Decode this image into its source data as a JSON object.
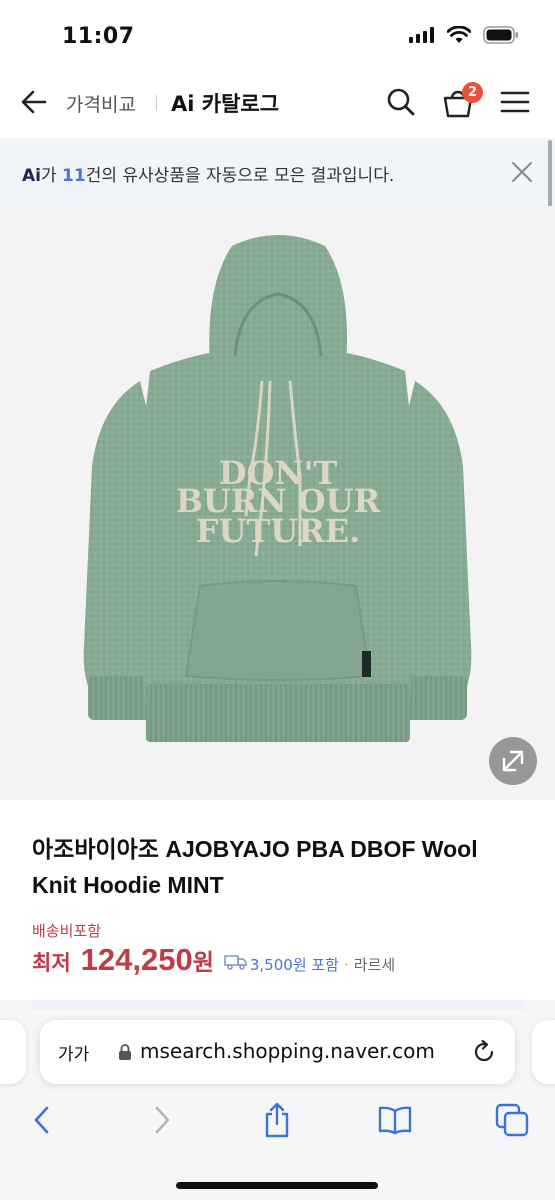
{
  "status_bar": {
    "time": "11:07"
  },
  "header": {
    "breadcrumb": "가격비교",
    "title": "Ai 카탈로그",
    "cart_badge_count": "2",
    "icons": [
      "back-arrow-icon",
      "search-icon",
      "cart-icon",
      "menu-icon"
    ]
  },
  "ai_banner": {
    "logo": "Ai",
    "text_before": "가 ",
    "count": "11",
    "text_after": "건의 유사상품을 자동으로 모은 결과입니다."
  },
  "product": {
    "image_graphic_text": "DON'T BURN OUR FUTURE.",
    "name": "아조바이아조 AJOBYAJO PBA DBOF Wool Knit Hoodie MINT",
    "shipping_label": "배송비포함",
    "price_prefix": "최저",
    "price_value": "124,250",
    "price_unit": "원",
    "shipping_fee": "3,500원 포함",
    "separator": "·",
    "seller": "라르세"
  },
  "browser": {
    "text_size_label": "가가",
    "url": "msearch.shopping.naver.com",
    "toolbar_icons": [
      "back-icon",
      "forward-icon",
      "share-icon",
      "bookmarks-icon",
      "tabs-icon"
    ]
  },
  "colors": {
    "price_red": "#c03a48",
    "accent_blue": "#4a74d6",
    "badge_red": "#e8513b",
    "banner_bg": "#f1f4f9",
    "hoodie_mint": "#88ab94"
  }
}
